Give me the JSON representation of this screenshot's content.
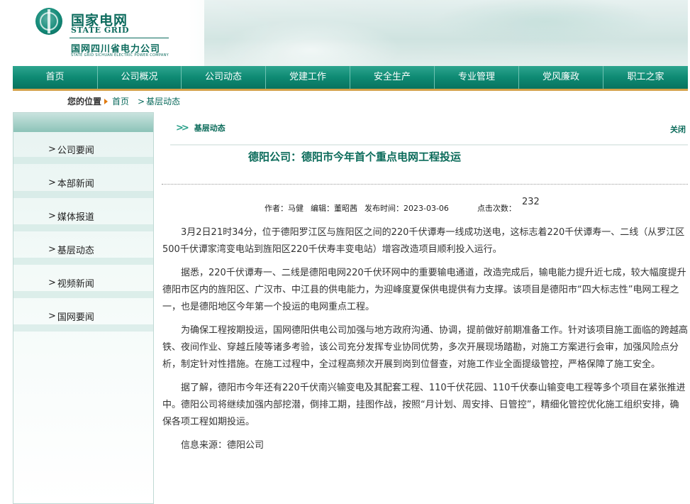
{
  "header": {
    "brand_cn": "国家电网",
    "brand_en": "STATE GRID",
    "company_cn": "国网四川省电力公司",
    "company_en": "STATE GRID SICHUAN ELECTRIC POWER COMPANY"
  },
  "nav": {
    "items": [
      "首页",
      "公司概况",
      "公司动态",
      "党建工作",
      "安全生产",
      "专业管理",
      "党风廉政",
      "职工之家"
    ]
  },
  "breadcrumb": {
    "label": "您的位置",
    "home": "首页",
    "current": "基层动态",
    "sep": ">"
  },
  "sidebar": {
    "items": [
      "公司要闻",
      "本部新闻",
      "媒体报道",
      "基层动态",
      "视频新闻",
      "国网要闻"
    ]
  },
  "content": {
    "section": "基层动态",
    "close": "关闭",
    "title": "德阳公司：德阳市今年首个重点电网工程投运",
    "meta": {
      "author": "作者：马健",
      "editor": "编辑：董昭茜",
      "date": "发布时间：2023-03-06",
      "hits_label": "点击次数：",
      "hits_value": "232"
    },
    "paragraphs": [
      "3月2日21时34分，位于德阳罗江区与旌阳区之间的220千伏谭寿一线成功送电，这标志着220千伏谭寿一、二线（从罗江区500千伏谭家湾变电站到旌阳区220千伏寿丰变电站）增容改造项目顺利投入运行。",
      "据悉，220千伏谭寿一、二线是德阳电网220千伏环网中的重要输电通道，改造完成后，输电能力提升近七成，较大幅度提升德阳市区内的旌阳区、广汉市、中江县的供电能力，为迎峰度夏保供电提供有力支撑。该项目是德阳市“四大标志性”电网工程之一，也是德阳地区今年第一个投运的电网重点工程。",
      "为确保工程按期投运，国网德阳供电公司加强与地方政府沟通、协调，提前做好前期准备工作。针对该项目施工面临的跨越高铁、夜间作业、穿越丘陵等诸多考验，该公司充分发挥专业协同优势，多次开展现场踏勘，对施工方案进行会审，加强风险点分析，制定针对性措施。在施工过程中，全过程高频次开展到岗到位督查，对施工作业全面提级管控，严格保障了施工安全。",
      "据了解，德阳市今年还有220千伏南兴输变电及其配套工程、110千伏花园、110千伏泰山输变电工程等多个项目在紧张推进中。德阳公司将继续加强内部挖潜，倒排工期，挂图作战，按照“月计划、周安排、日管控”，精细化管控优化施工组织安排，确保各项工程如期投运。"
    ],
    "source": "信息来源：德阳公司"
  },
  "colors": {
    "brand_green": "#0c6b5d",
    "nav_green": "#0e8a73",
    "accent_gold": "#d4a14a",
    "breadcrumb_arrow": "#e07a10"
  }
}
